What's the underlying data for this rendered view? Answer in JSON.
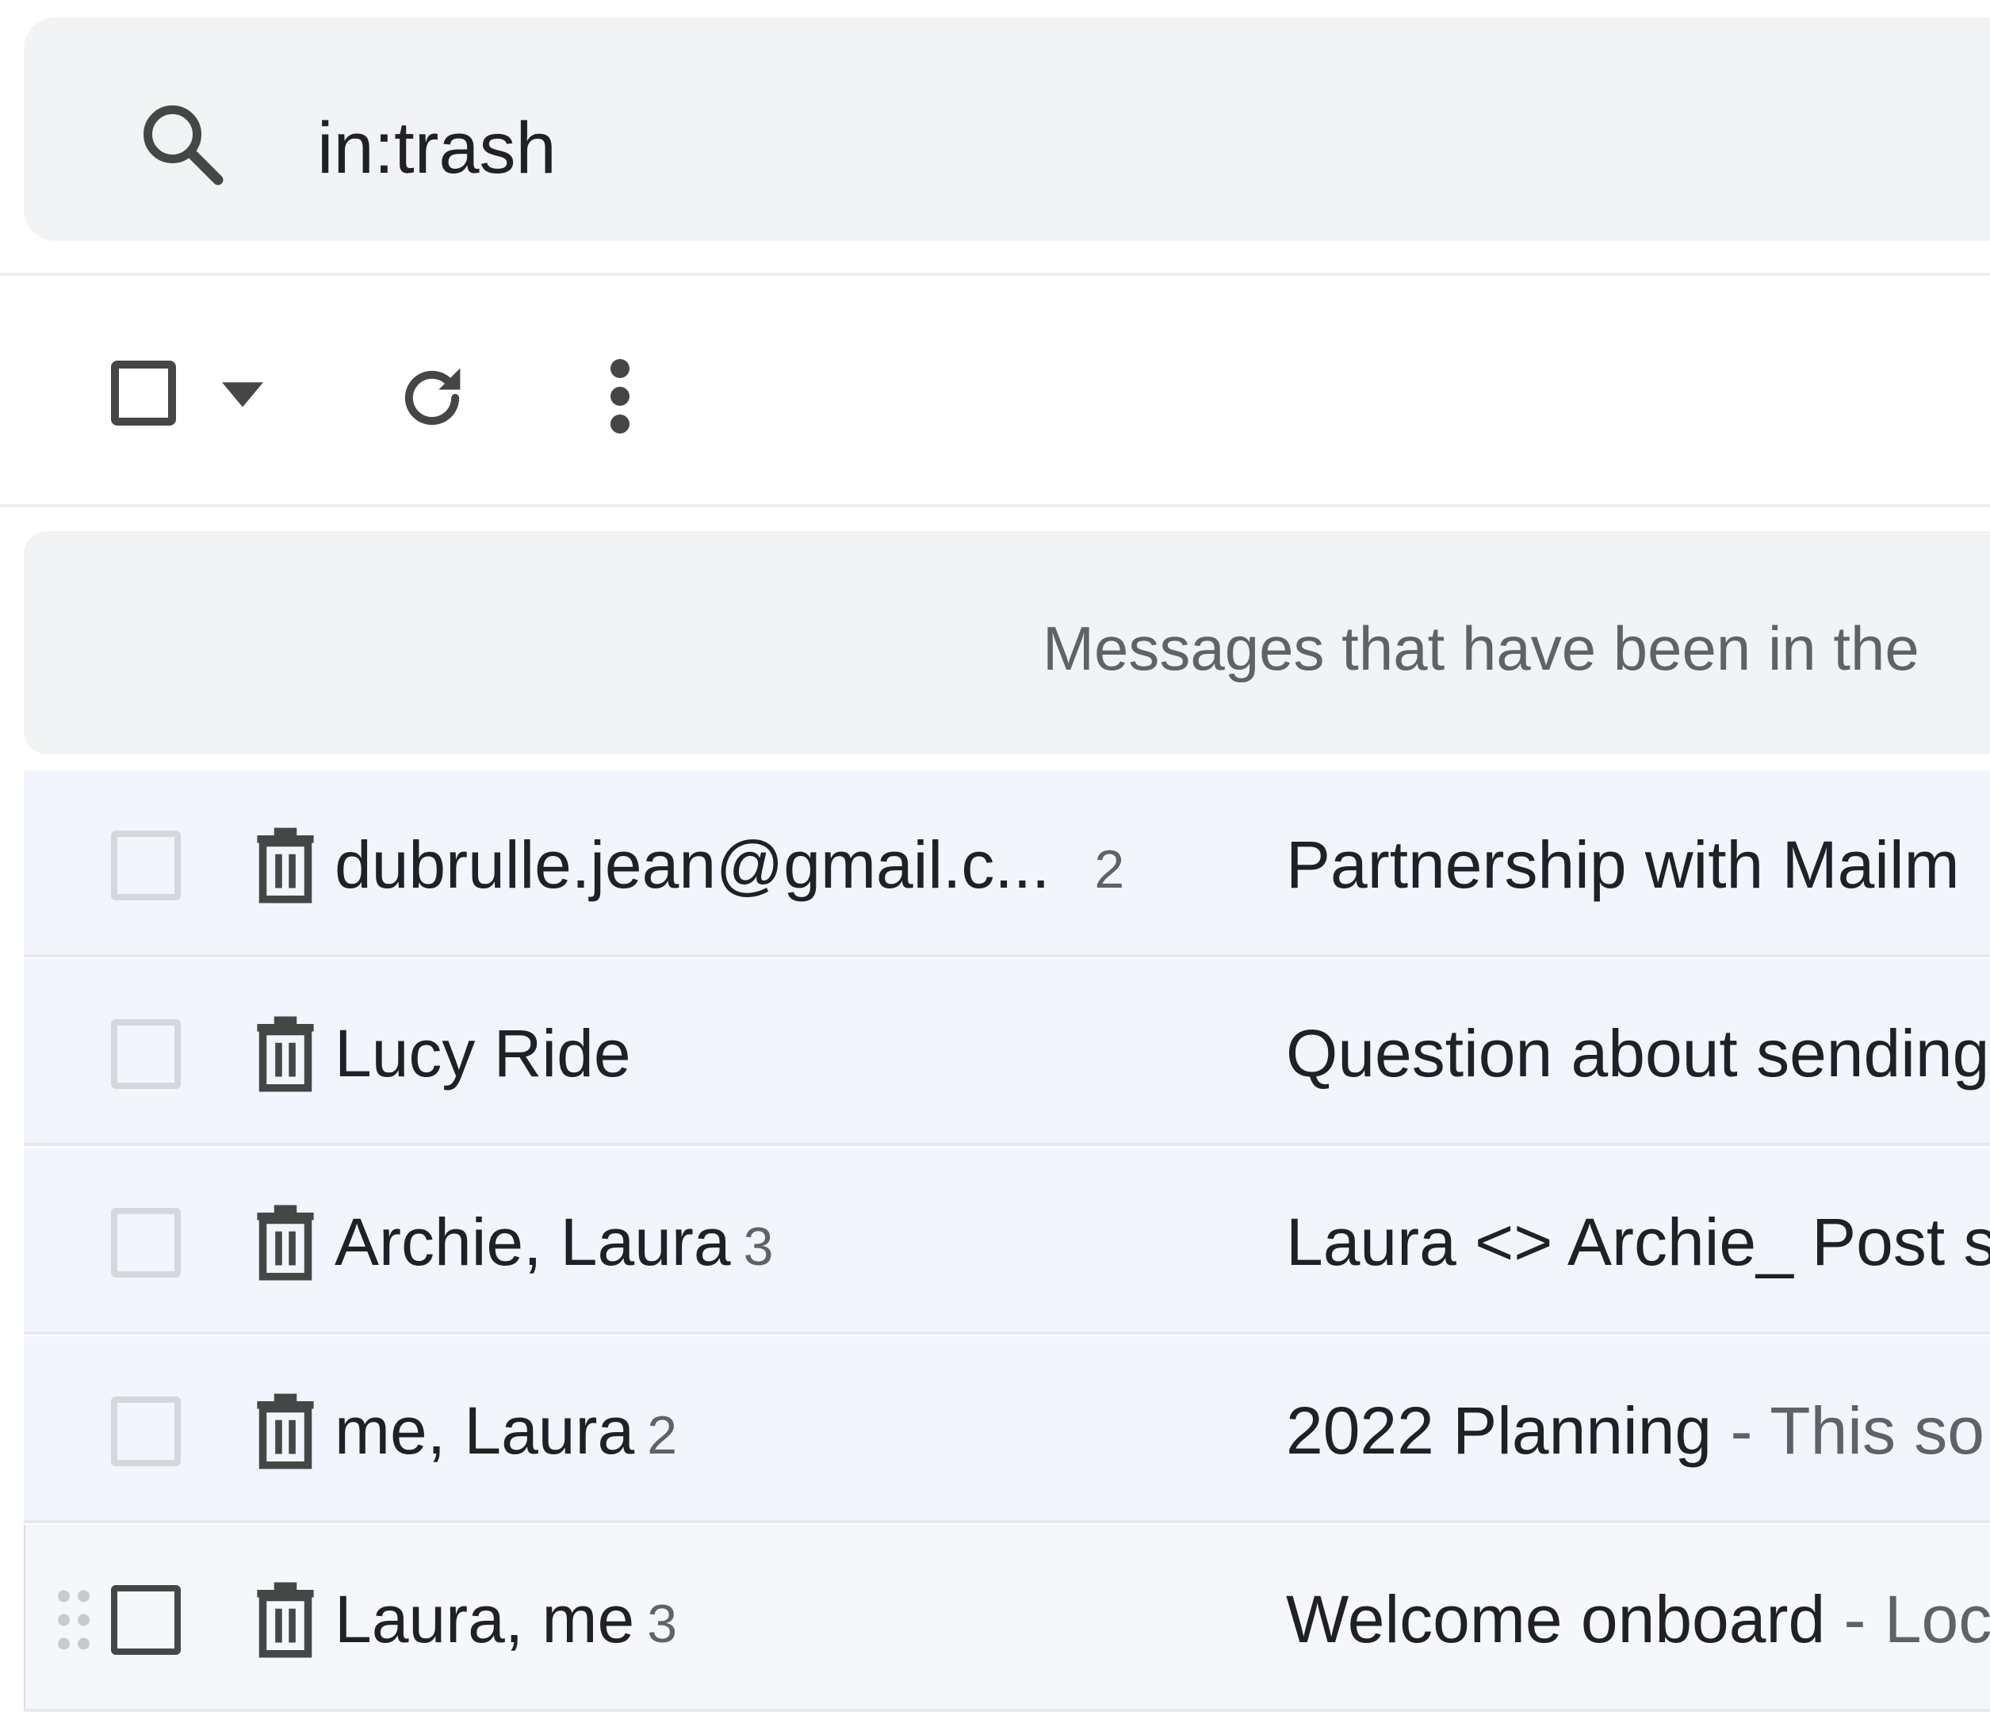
{
  "search": {
    "query": "in:trash",
    "icon": "search-icon"
  },
  "toolbar": {
    "select_all_icon": "checkbox-icon",
    "select_dropdown_icon": "caret-down-icon",
    "refresh_icon": "refresh-icon",
    "more_icon": "more-vertical-icon"
  },
  "banner": {
    "text": "Messages that have been in the"
  },
  "emails": [
    {
      "sender": "dubrulle.jean@gmail.c...",
      "count": "2",
      "subject": "Partnership with Mailm",
      "snippet": ""
    },
    {
      "sender": "Lucy Ride",
      "count": "",
      "subject": "Question about sending",
      "snippet": ""
    },
    {
      "sender": "Archie, Laura",
      "count": "3",
      "subject": "Laura <> Archie_ Post s",
      "snippet": ""
    },
    {
      "sender": "me, Laura",
      "count": "2",
      "subject": "2022 Planning",
      "snippet": " - This so"
    },
    {
      "sender": "Laura, me",
      "count": "3",
      "subject": "Welcome onboard",
      "snippet": " - Loc"
    }
  ],
  "colors": {
    "search_bg": "#f1f3f4",
    "row_bg": "#f2f6fc",
    "text_primary": "#202124",
    "text_secondary": "#5f6368"
  }
}
